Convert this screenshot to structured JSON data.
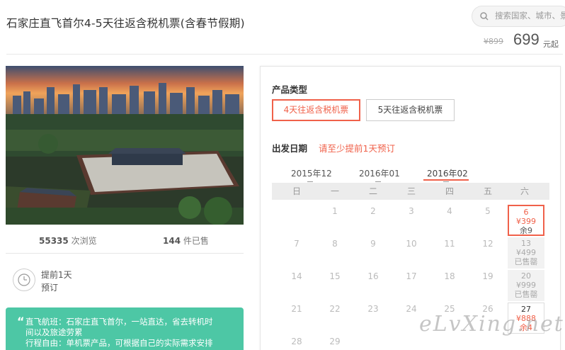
{
  "title": "石家庄直飞首尔4-5天往返含税机票(含春节假期)",
  "search": {
    "placeholder": "搜索国家、城市、景点"
  },
  "price": {
    "old": "¥899",
    "current": "699",
    "unit": "元起"
  },
  "stats": {
    "views": "55335",
    "views_label": "次浏览",
    "sold": "144",
    "sold_label": "件已售"
  },
  "advance": {
    "line1": "提前1天",
    "line2": "预订"
  },
  "notes": {
    "quote": "“",
    "line1": "直飞航班：石家庄直飞首尔，一站直达，省去转机时",
    "line2": "间以及旅途劳累",
    "line3": "行程自由：单机票产品，可根据自己的实际需求安排"
  },
  "product_type": {
    "label": "产品类型",
    "options": [
      "4天往返含税机票",
      "5天往返含税机票"
    ]
  },
  "departure": {
    "label": "出发日期",
    "tip": "请至少提前1天预订"
  },
  "months": [
    "2015年12",
    "2016年01",
    "2016年02"
  ],
  "weekdays": [
    "日",
    "一",
    "二",
    "三",
    "四",
    "五",
    "六"
  ],
  "calendar": {
    "days": [
      "1",
      "2",
      "3",
      "4",
      "5",
      "7",
      "8",
      "9",
      "10",
      "11",
      "12",
      "14",
      "15",
      "16",
      "17",
      "18",
      "19",
      "21",
      "22",
      "23",
      "24",
      "25",
      "26",
      "28",
      "29"
    ],
    "cells": [
      {
        "day": "6",
        "price": "¥399",
        "status": "余9",
        "state": "available"
      },
      {
        "day": "13",
        "price": "¥499",
        "status": "已售罄",
        "state": "soldout"
      },
      {
        "day": "20",
        "price": "¥999",
        "status": "已售罄",
        "state": "soldout"
      },
      {
        "day": "27",
        "price": "¥888",
        "status": "余4",
        "state": "normal"
      }
    ]
  },
  "watermark": "eLvXing.net",
  "colors": {
    "accent": "#f0614a",
    "green": "#4dc7a5"
  }
}
